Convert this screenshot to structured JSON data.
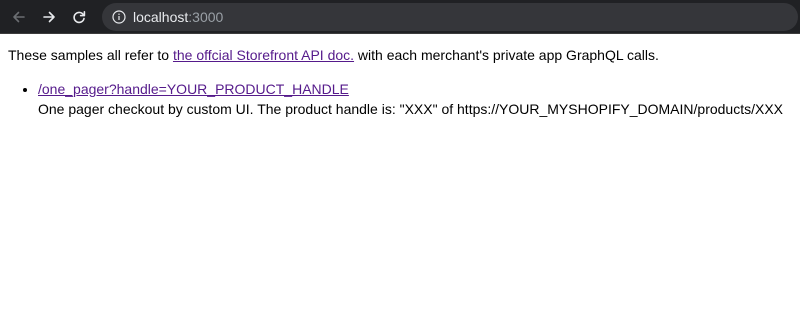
{
  "browser": {
    "url_host": "localhost",
    "url_port": ":3000",
    "icons": {
      "back": "arrow-left-icon",
      "forward": "arrow-right-icon",
      "reload": "reload-icon",
      "info": "info-circle-icon"
    }
  },
  "page": {
    "intro_before": "These samples all refer to ",
    "intro_link": "the offcial Storefront API doc.",
    "intro_after": " with each merchant's private app GraphQL calls.",
    "samples": [
      {
        "link": "/one_pager?handle=YOUR_PRODUCT_HANDLE",
        "description": "One pager checkout by custom UI. The product handle is: \"XXX\" of https://YOUR_MYSHOPIFY_DOMAIN/products/XXX"
      }
    ]
  },
  "colors": {
    "toolbar_bg": "#202124",
    "omnibox_bg": "#35363a",
    "link": "#551a8b"
  }
}
